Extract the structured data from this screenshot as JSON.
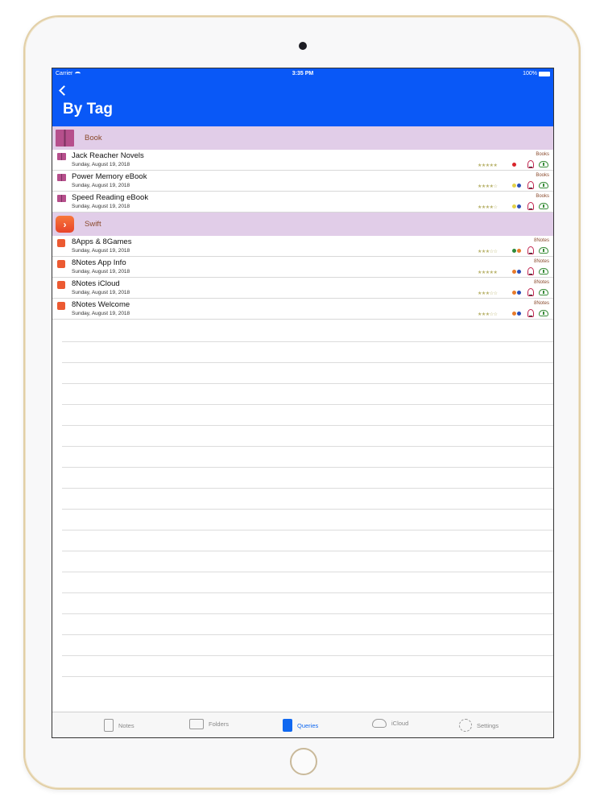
{
  "status_bar": {
    "carrier": "Carrier",
    "time": "3:35 PM",
    "battery": "100%"
  },
  "nav": {
    "title": "By Tag"
  },
  "sections": [
    {
      "label": "Book",
      "rows": [
        {
          "title": "Jack Reacher Novels",
          "date": "Sunday, August 19, 2018",
          "tag": "Books",
          "stars": "★★★★★",
          "dots": [
            "#d9252b"
          ]
        },
        {
          "title": "Power Memory eBook",
          "date": "Sunday, August 19, 2018",
          "tag": "Books",
          "stars": "★★★★☆",
          "dots": [
            "#e3d24a",
            "#2b4fb8"
          ]
        },
        {
          "title": "Speed Reading eBook",
          "date": "Sunday, August 19, 2018",
          "tag": "Books",
          "stars": "★★★★☆",
          "dots": [
            "#e3d24a",
            "#2b4fb8"
          ]
        }
      ]
    },
    {
      "label": "Swift",
      "rows": [
        {
          "title": "8Apps & 8Games",
          "date": "Sunday, August 19, 2018",
          "tag": "8Notes",
          "stars": "★★★☆☆",
          "dots": [
            "#2e8b3a",
            "#e87b2a"
          ]
        },
        {
          "title": "8Notes App Info",
          "date": "Sunday, August 19, 2018",
          "tag": "8Notes",
          "stars": "★★★★★",
          "dots": [
            "#e87b2a",
            "#2b4fb8"
          ]
        },
        {
          "title": "8Notes iCloud",
          "date": "Sunday, August 19, 2018",
          "tag": "8Notes",
          "stars": "★★★☆☆",
          "dots": [
            "#e87b2a",
            "#2b4fb8"
          ]
        },
        {
          "title": "8Notes Welcome",
          "date": "Sunday, August 19, 2018",
          "tag": "8Notes",
          "stars": "★★★☆☆",
          "dots": [
            "#e87b2a",
            "#2b4fb8"
          ]
        }
      ]
    }
  ],
  "tabs": [
    {
      "label": "Notes",
      "icon": "notes-icon",
      "active": false
    },
    {
      "label": "Folders",
      "icon": "folders-icon",
      "active": false
    },
    {
      "label": "Queries",
      "icon": "queries-icon",
      "active": true
    },
    {
      "label": "iCloud",
      "icon": "icloud-icon",
      "active": false
    },
    {
      "label": "Settings",
      "icon": "settings-icon",
      "active": false
    }
  ],
  "colors": {
    "nav": "#0958f7",
    "section_bg": "#e1cde8",
    "active_tab": "#1068f0"
  }
}
